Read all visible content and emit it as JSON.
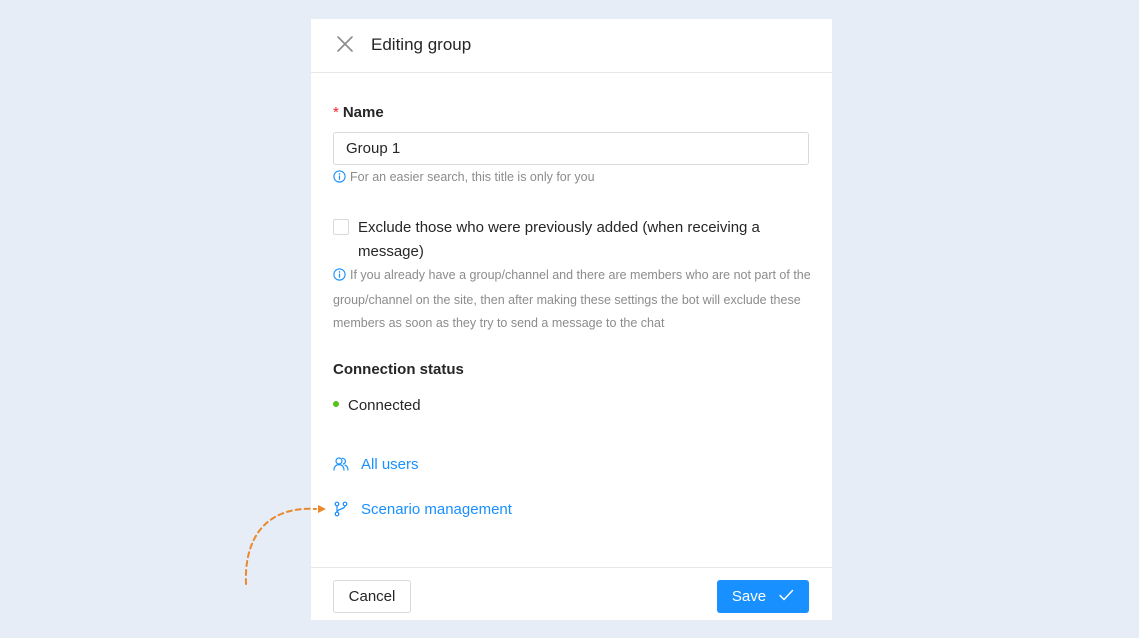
{
  "header": {
    "title": "Editing group",
    "close_icon": "close-icon"
  },
  "form": {
    "name_label": "Name",
    "required_mark": "*",
    "name_value": "Group 1",
    "name_hint": "For an easier search, this title is only for you",
    "exclude_label": "Exclude those who were previously added (when receiving a message)",
    "exclude_checked": false,
    "exclude_hint": "If you already have a group/channel and there are members who are not part of the group/channel on the site, then after making these settings the bot will exclude these members as soon as they try to send a message to the chat"
  },
  "connection": {
    "title": "Connection status",
    "status": "Connected",
    "status_color": "#52c41a"
  },
  "links": {
    "all_users": "All users",
    "scenario_management": "Scenario management"
  },
  "footer": {
    "cancel_label": "Cancel",
    "save_label": "Save"
  },
  "colors": {
    "accent": "#1890ff",
    "background": "#e6edf6",
    "required": "#f5222d",
    "annotation_arrow": "#e8892e"
  }
}
